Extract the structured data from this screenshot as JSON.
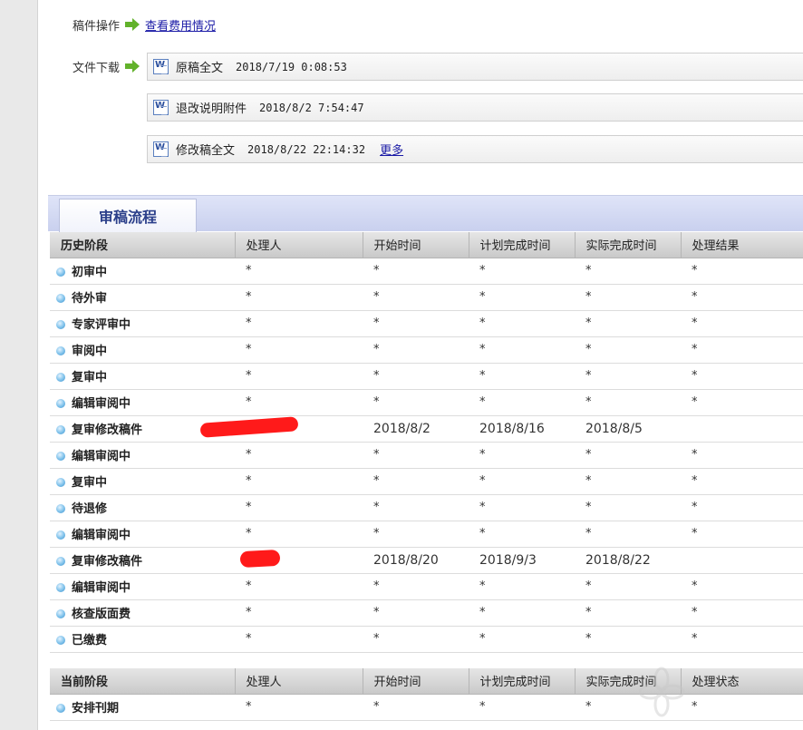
{
  "ops": {
    "label": "稿件操作",
    "fee_link": "查看费用情况"
  },
  "downloads": {
    "label": "文件下载",
    "files": [
      {
        "name": "原稿全文",
        "time": "2018/7/19 0:08:53",
        "more": ""
      },
      {
        "name": "退改说明附件",
        "time": "2018/8/2 7:54:47",
        "more": ""
      },
      {
        "name": "修改稿全文",
        "time": "2018/8/22 22:14:32",
        "more": "更多"
      }
    ]
  },
  "process": {
    "tab_label": "审稿流程"
  },
  "history": {
    "headers": [
      "历史阶段",
      "处理人",
      "开始时间",
      "计划完成时间",
      "实际完成时间",
      "处理结果"
    ],
    "rows": [
      {
        "stage": "初审中",
        "handler": "*",
        "start": "*",
        "planned": "*",
        "actual": "*",
        "result": "*"
      },
      {
        "stage": "待外审",
        "handler": "*",
        "start": "*",
        "planned": "*",
        "actual": "*",
        "result": "*"
      },
      {
        "stage": "专家评审中",
        "handler": "*",
        "start": "*",
        "planned": "*",
        "actual": "*",
        "result": "*"
      },
      {
        "stage": "审阅中",
        "handler": "*",
        "start": "*",
        "planned": "*",
        "actual": "*",
        "result": "*"
      },
      {
        "stage": "复审中",
        "handler": "*",
        "start": "*",
        "planned": "*",
        "actual": "*",
        "result": "*"
      },
      {
        "stage": "编辑审阅中",
        "handler": "*",
        "start": "*",
        "planned": "*",
        "actual": "*",
        "result": "*"
      },
      {
        "stage": "复审修改稿件",
        "handler": "",
        "start": "2018/8/2",
        "planned": "2018/8/16",
        "actual": "2018/8/5",
        "result": ""
      },
      {
        "stage": "编辑审阅中",
        "handler": "*",
        "start": "*",
        "planned": "*",
        "actual": "*",
        "result": "*"
      },
      {
        "stage": "复审中",
        "handler": "*",
        "start": "*",
        "planned": "*",
        "actual": "*",
        "result": "*"
      },
      {
        "stage": "待退修",
        "handler": "*",
        "start": "*",
        "planned": "*",
        "actual": "*",
        "result": "*"
      },
      {
        "stage": "编辑审阅中",
        "handler": "*",
        "start": "*",
        "planned": "*",
        "actual": "*",
        "result": "*"
      },
      {
        "stage": "复审修改稿件",
        "handler": "",
        "start": "2018/8/20",
        "planned": "2018/9/3",
        "actual": "2018/8/22",
        "result": ""
      },
      {
        "stage": "编辑审阅中",
        "handler": "*",
        "start": "*",
        "planned": "*",
        "actual": "*",
        "result": "*"
      },
      {
        "stage": "核查版面费",
        "handler": "*",
        "start": "*",
        "planned": "*",
        "actual": "*",
        "result": "*"
      },
      {
        "stage": "已缴费",
        "handler": "*",
        "start": "*",
        "planned": "*",
        "actual": "*",
        "result": "*"
      }
    ]
  },
  "current": {
    "headers": [
      "当前阶段",
      "处理人",
      "开始时间",
      "计划完成时间",
      "实际完成时间",
      "处理状态"
    ],
    "rows": [
      {
        "stage": "安排刊期",
        "handler": "*",
        "start": "*",
        "planned": "*",
        "actual": "*",
        "result": "*"
      }
    ]
  },
  "colors": {
    "arrow": "#62b22b",
    "link": "#1a1aa6",
    "tab_text": "#2b3f8a",
    "redaction": "#ff1a1a"
  }
}
